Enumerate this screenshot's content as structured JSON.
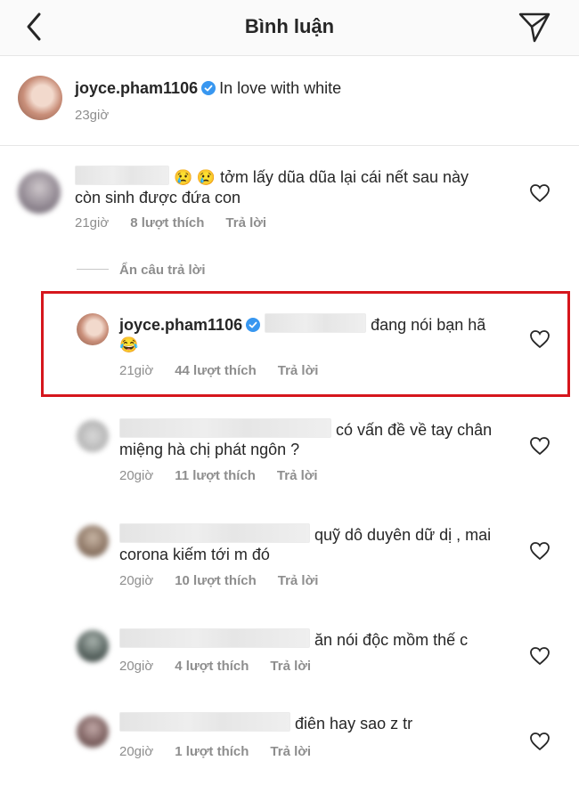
{
  "header": {
    "title": "Bình luận"
  },
  "caption": {
    "username": "joyce.pham1106",
    "text": "In love with white",
    "time": "23giờ"
  },
  "hide_replies": "Ẩn câu trả lời",
  "comments": [
    {
      "text": "tởm lấy dũa dũa lại cái nết sau này còn sinh được đứa con",
      "emoji": "😢 😢",
      "time": "21giờ",
      "likes": "8 lượt thích",
      "reply": "Trả lời"
    },
    {
      "username": "joyce.pham1106",
      "text": "đang nói bạn hã",
      "emoji": "😂",
      "time": "21giờ",
      "likes": "44 lượt thích",
      "reply": "Trả lời"
    },
    {
      "text": "có vấn đề về tay chân miệng hà chị phát ngôn ?",
      "time": "20giờ",
      "likes": "11 lượt thích",
      "reply": "Trả lời"
    },
    {
      "text": "quỹ dô duyên dữ dị , mai corona kiếm tới m đó",
      "time": "20giờ",
      "likes": "10 lượt thích",
      "reply": "Trả lời"
    },
    {
      "text": "ăn nói độc mồm thế c",
      "time": "20giờ",
      "likes": "4 lượt thích",
      "reply": "Trả lời"
    },
    {
      "text": "điên hay sao z tr",
      "time": "20giờ",
      "likes": "1 lượt thích",
      "reply": "Trả lời"
    }
  ]
}
